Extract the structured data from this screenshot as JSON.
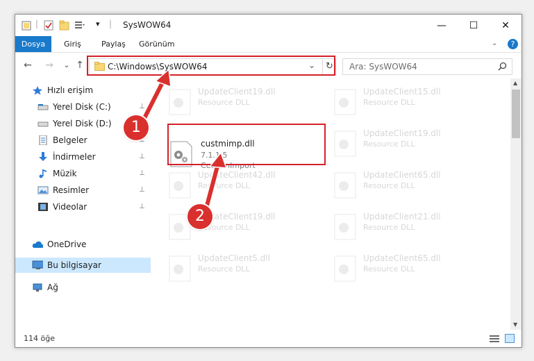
{
  "window": {
    "title": "SysWOW64",
    "minimize_glyph": "—",
    "maximize_glyph": "☐",
    "close_glyph": "✕"
  },
  "ribbon": {
    "tabs": [
      "Dosya",
      "Giriş",
      "Paylaş",
      "Görünüm"
    ],
    "help_glyph": "?"
  },
  "address": {
    "path": "C:\\Windows\\SysWOW64",
    "dropdown_glyph": "⌄",
    "refresh_glyph": "↻"
  },
  "search": {
    "placeholder": "Ara: SysWOW64",
    "icon": "search-icon"
  },
  "nav_buttons": {
    "back": "←",
    "forward": "→",
    "recent": "⌄",
    "up": "↑"
  },
  "sidebar": {
    "items": [
      {
        "label": "Hızlı erişim",
        "icon": "star-icon"
      },
      {
        "label": "Yerel Disk (C:)",
        "icon": "drive-icon",
        "pinned": true
      },
      {
        "label": "Yerel Disk (D:)",
        "icon": "drive-icon",
        "pinned": true
      },
      {
        "label": "Belgeler",
        "icon": "documents-icon",
        "pinned": true
      },
      {
        "label": "İndirmeler",
        "icon": "download-icon",
        "pinned": true
      },
      {
        "label": "Müzik",
        "icon": "music-icon",
        "pinned": true
      },
      {
        "label": "Resimler",
        "icon": "pictures-icon",
        "pinned": true
      },
      {
        "label": "Videolar",
        "icon": "video-icon",
        "pinned": true
      },
      {
        "label": "OneDrive",
        "icon": "cloud-icon"
      },
      {
        "label": "Bu bilgisayar",
        "icon": "computer-icon",
        "selected": true
      },
      {
        "label": "Ağ",
        "icon": "network-icon"
      }
    ],
    "pin_glyph": "📌"
  },
  "files": {
    "highlighted": {
      "name": "custmimp.dll",
      "version": "7.1.1.5",
      "description": "CustomImport"
    },
    "background": [
      {
        "name": "UpdateClient19.dll",
        "description": "Resource DLL"
      },
      {
        "name": "UpdateClient15.dll",
        "description": "Resource DLL"
      },
      {
        "name": "UpdateClient19.dll",
        "description": "Resource DLL"
      },
      {
        "name": "UpdateClient42.dll",
        "description": "Resource DLL"
      },
      {
        "name": "UpdateClient65.dll",
        "description": "Resource DLL"
      },
      {
        "name": "UpdateClient19.dll",
        "description": "Resource DLL"
      },
      {
        "name": "UpdateClient21.dll",
        "description": "Resource DLL"
      },
      {
        "name": "UpdateClient5.dll",
        "description": "Resource DLL"
      },
      {
        "name": "UpdateClient65.dll",
        "description": "Resource DLL"
      }
    ]
  },
  "status": {
    "item_count": "114 öğe"
  },
  "annotations": {
    "step1": "1",
    "step2": "2",
    "highlight_color": "#d42027",
    "badge_color": "#d9302e"
  },
  "colors": {
    "accent": "#1979ca",
    "selection": "#cce8ff"
  }
}
